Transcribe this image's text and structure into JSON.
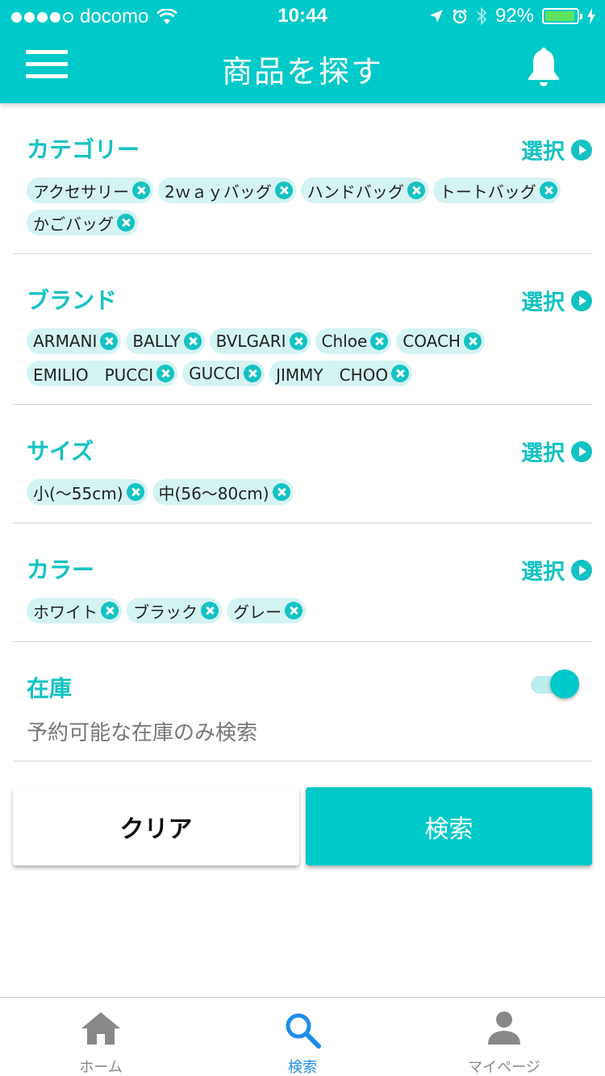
{
  "status_bar": {
    "carrier": "docomo",
    "time": "10:44",
    "battery": "92%",
    "signal_bars": 4,
    "battery_level": 0.92
  },
  "header": {
    "title": "商品を探す",
    "menu_icon": "hamburger-menu-icon",
    "bell_icon": "bell-icon"
  },
  "sections": {
    "category": {
      "title": "カテゴリー",
      "select_label": "選択",
      "chips": [
        "アクセサリー",
        "2ｗａｙバッグ",
        "ハンドバッグ",
        "トートバッグ",
        "かごバッグ"
      ]
    },
    "brand": {
      "title": "ブランド",
      "select_label": "選択",
      "chips": [
        "ARMANI",
        "BALLY",
        "BVLGARI",
        "Chloe",
        "COACH",
        "EMILIO　PUCCI",
        "GUCCI",
        "JIMMY　CHOO"
      ]
    },
    "size": {
      "title": "サイズ",
      "select_label": "選択",
      "chips": [
        "小(〜55cm)",
        "中(56〜80cm)"
      ]
    },
    "color": {
      "title": "カラー",
      "select_label": "選択",
      "chips": [
        "ホワイト",
        "ブラック",
        "グレー"
      ]
    },
    "stock": {
      "title": "在庫",
      "description": "予約可能な在庫のみ検索",
      "toggle_on": true
    }
  },
  "buttons": {
    "clear": "クリア",
    "search": "検索"
  },
  "tabbar": {
    "tabs": [
      {
        "label": "ホーム",
        "icon": "home-icon",
        "active": false
      },
      {
        "label": "検索",
        "icon": "search-icon",
        "active": true
      },
      {
        "label": "マイページ",
        "icon": "person-icon",
        "active": false
      }
    ]
  },
  "colors": {
    "accent": "#00c9c9",
    "chip_bg": "#d4f3f3",
    "tab_active": "#1e8de8",
    "tab_inactive": "#888888"
  }
}
